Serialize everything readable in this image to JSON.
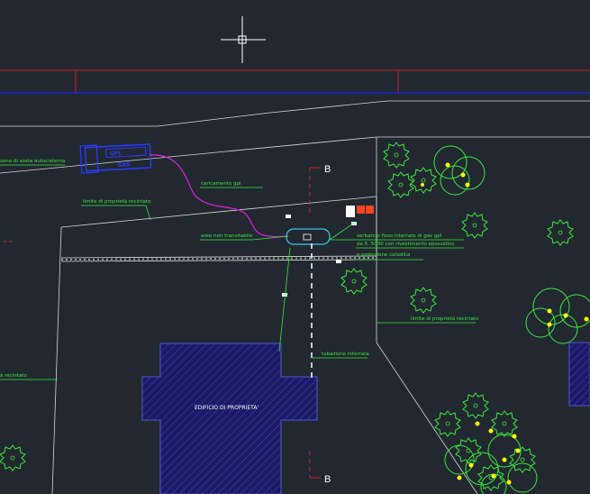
{
  "colors": {
    "background": "#212830",
    "line_white": "#d8d8d8",
    "label_green": "#3ee63e",
    "road_red": "#d42020",
    "road_blue": "#2222dd",
    "magenta": "#e020e0",
    "cyan": "#40c8e8",
    "building_blue": "#1a1a66",
    "tree_green": "#3ee63e",
    "tree_yellow": "#ffff00"
  },
  "labels": {
    "zona_autocisterna": "zona di sosta autocisterna",
    "caricamento": "caricamento gpl",
    "limite_top": "limite di proprietà recintato",
    "area_non": "area non transitabile",
    "serbatoio_1": "serbatoio fisso interrato di gas gpl",
    "serbatoio_2": "da lt. 5000 con rivestimento epossidico",
    "serbatoio_3": "e protezione catodica",
    "limite_right": "limite di proprietà recintato",
    "tubazione": "tubazione interrata",
    "limite_left": "à recintato",
    "edificio": "EDIFICIO DI PROPRIETA'",
    "section_top": "B",
    "section_bottom": "B",
    "tank_label_1": "GPL",
    "tank_label_2": "GAS"
  }
}
